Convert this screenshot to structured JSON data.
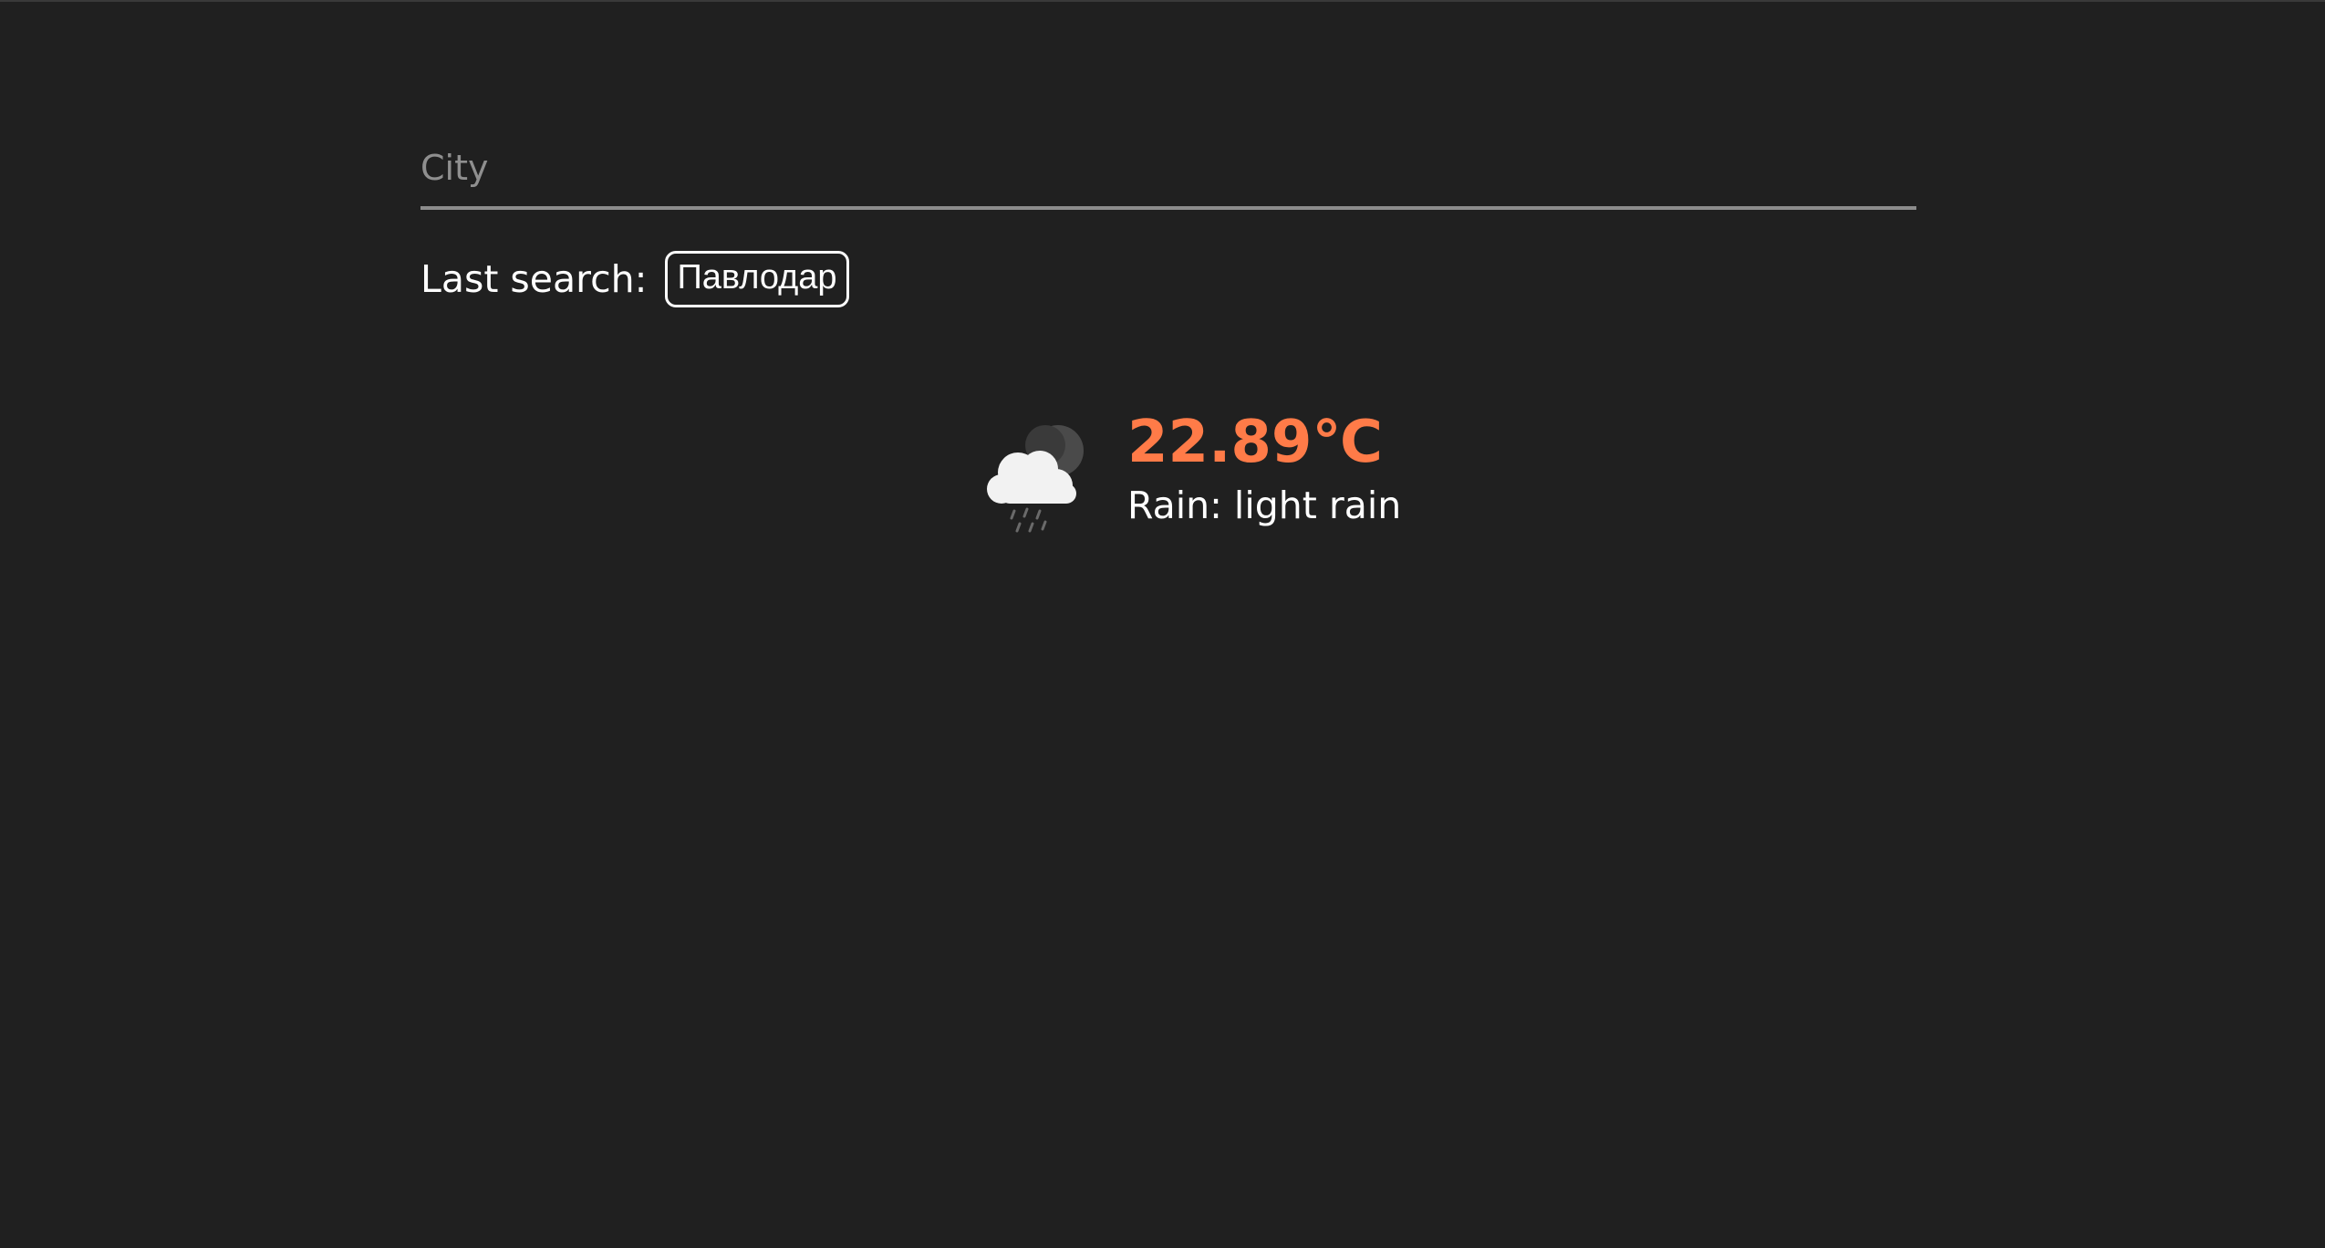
{
  "search": {
    "placeholder": "City",
    "value": ""
  },
  "history": {
    "label": "Last search:",
    "items": [
      "Павлодар"
    ]
  },
  "weather": {
    "icon": "cloud-moon-rain-icon",
    "temperature": "22.89℃",
    "description": "Rain: light rain"
  },
  "colors": {
    "background": "#202020",
    "accent": "#ff7b48",
    "text": "#ffffff",
    "muted": "#8f8f8f"
  }
}
